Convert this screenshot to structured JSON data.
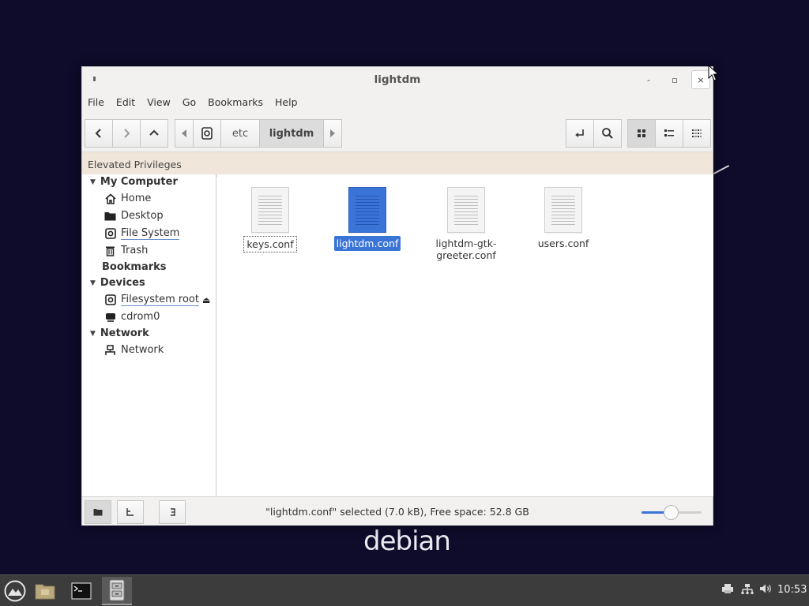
{
  "desktop": {
    "brand_text": "debian",
    "background_color": "#0e0b2b"
  },
  "window": {
    "title": "lightdm",
    "controls": {
      "minimize": "-",
      "maximize": "▫",
      "close": "×"
    }
  },
  "menubar": {
    "items": [
      "File",
      "Edit",
      "View",
      "Go",
      "Bookmarks",
      "Help"
    ]
  },
  "toolbar": {
    "nav_buttons": [
      "back-icon",
      "forward-icon",
      "up-icon"
    ],
    "breadcrumbs": [
      "etc",
      "lightdm"
    ],
    "current_crumb": "lightdm",
    "right_buttons": [
      "open-terminal-icon",
      "search-icon",
      "icon-view-icon",
      "list-view-icon",
      "compact-view-icon"
    ]
  },
  "privileges_bar": {
    "text": "Elevated Privileges",
    "color": "#f0e7da"
  },
  "sidebar": {
    "sections": [
      {
        "title": "My Computer",
        "items": [
          "Home",
          "Desktop",
          "File System",
          "Trash"
        ]
      },
      {
        "title": "Bookmarks",
        "items": []
      },
      {
        "title": "Devices",
        "items": [
          "Filesystem root",
          "cdrom0"
        ]
      },
      {
        "title": "Network",
        "items": [
          "Network"
        ]
      }
    ]
  },
  "files": [
    {
      "name": "keys.conf",
      "selected": false
    },
    {
      "name": "lightdm.conf",
      "selected": true
    },
    {
      "name": "lightdm-gtk-greeter.conf",
      "name_line1": "lightdm-gtk-",
      "name_line2": "greeter.conf",
      "selected": false
    },
    {
      "name": "users.conf",
      "selected": false
    }
  ],
  "statusbar": {
    "text": "\"lightdm.conf\" selected (7.0 kB), Free space: 52.8 GB",
    "zoom_level": 0.5,
    "accent": "#3b74d7"
  },
  "taskbar": {
    "apps": [
      "menu-icon",
      "files-icon",
      "terminal-icon",
      "file-manager-icon"
    ],
    "tray_icons": [
      "printer-icon",
      "network-icon",
      "volume-icon"
    ],
    "clock": "10:53"
  }
}
